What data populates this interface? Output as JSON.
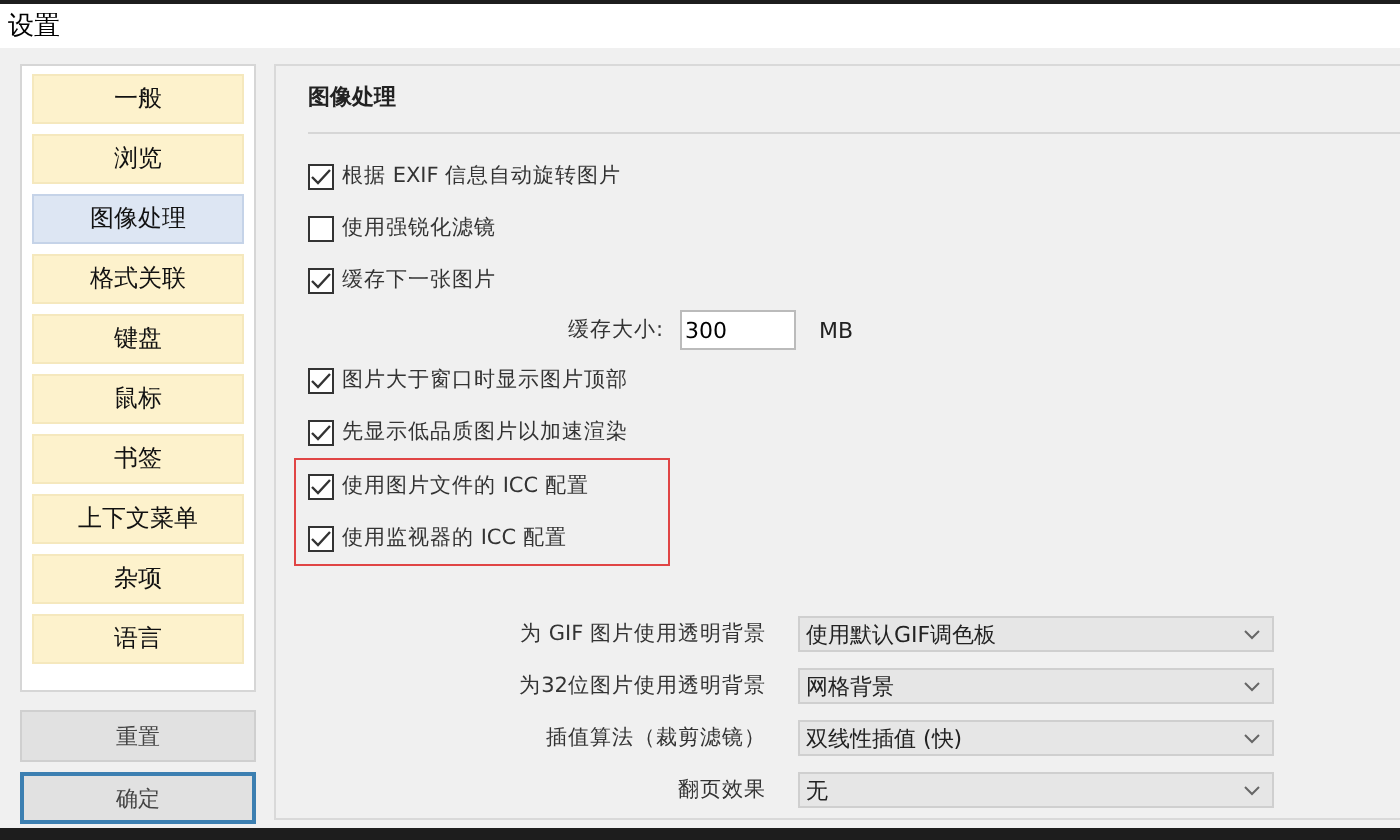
{
  "window": {
    "title": "设置"
  },
  "sidebar": {
    "items": [
      {
        "label": "一般",
        "selected": false
      },
      {
        "label": "浏览",
        "selected": false
      },
      {
        "label": "图像处理",
        "selected": true
      },
      {
        "label": "格式关联",
        "selected": false
      },
      {
        "label": "键盘",
        "selected": false
      },
      {
        "label": "鼠标",
        "selected": false
      },
      {
        "label": "书签",
        "selected": false
      },
      {
        "label": "上下文菜单",
        "selected": false
      },
      {
        "label": "杂项",
        "selected": false
      },
      {
        "label": "语言",
        "selected": false
      }
    ],
    "buttons": [
      {
        "label": "重置",
        "focused": false
      },
      {
        "label": "确定",
        "focused": true
      }
    ]
  },
  "panel": {
    "heading": "图像处理",
    "options": [
      {
        "kind": "checkbox",
        "label": "根据 EXIF 信息自动旋转图片",
        "checked": true,
        "highlighted": false
      },
      {
        "kind": "checkbox",
        "label": "使用强锐化滤镜",
        "checked": false,
        "highlighted": false
      },
      {
        "kind": "checkbox",
        "label": "缓存下一张图片",
        "checked": true,
        "highlighted": false
      },
      {
        "kind": "number",
        "label": "缓存大小:",
        "value": "300",
        "unit": "MB"
      },
      {
        "kind": "checkbox",
        "label": "图片大于窗口时显示图片顶部",
        "checked": true,
        "highlighted": false
      },
      {
        "kind": "checkbox",
        "label": "先显示低品质图片以加速渲染",
        "checked": true,
        "highlighted": false
      },
      {
        "kind": "checkbox",
        "label": "使用图片文件的 ICC 配置",
        "checked": true,
        "highlighted": true
      },
      {
        "kind": "checkbox",
        "label": "使用监视器的 ICC 配置",
        "checked": true,
        "highlighted": true
      }
    ],
    "selects": [
      {
        "label": "为 GIF 图片使用透明背景",
        "value": "使用默认GIF调色板"
      },
      {
        "label": "为32位图片使用透明背景",
        "value": "网格背景"
      },
      {
        "label": "插值算法（裁剪滤镜）",
        "value": "双线性插值 (快)"
      },
      {
        "label": "翻页效果",
        "value": "无"
      }
    ]
  }
}
